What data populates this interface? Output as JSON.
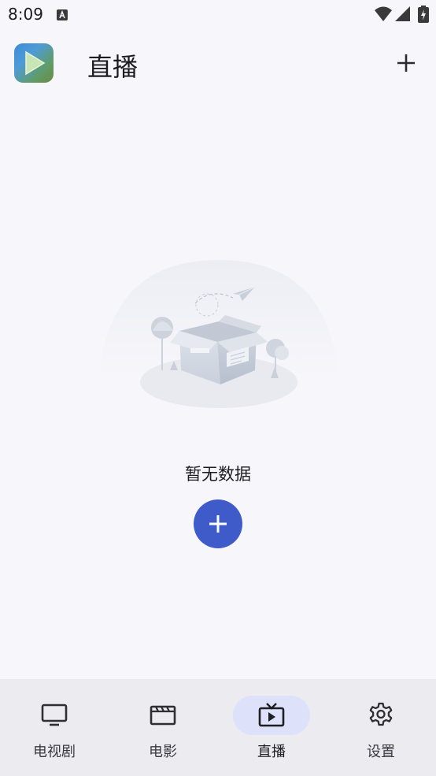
{
  "status_bar": {
    "time": "8:09"
  },
  "header": {
    "title": "直播"
  },
  "empty_state": {
    "message": "暂无数据"
  },
  "bottom_nav": {
    "items": [
      {
        "label": "电视剧",
        "icon": "tv-icon",
        "active": false
      },
      {
        "label": "电影",
        "icon": "clapperboard-icon",
        "active": false
      },
      {
        "label": "直播",
        "icon": "live-tv-icon",
        "active": true
      },
      {
        "label": "设置",
        "icon": "gear-icon",
        "active": false
      }
    ]
  },
  "colors": {
    "accent": "#3e5bc9",
    "active_pill": "#dde1f9",
    "background": "#f7f6fb",
    "nav_background": "#ecebf0"
  }
}
